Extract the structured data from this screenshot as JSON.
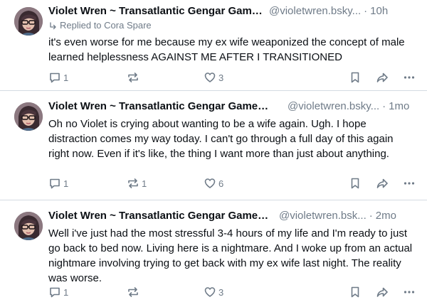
{
  "posts": [
    {
      "author": "Violet Wren ~ Transatlantic Gengar Gamer G...",
      "handle": "@violetwren.bsky...",
      "separator": "·",
      "time": "10h",
      "reply_to": "Replied to Cora Spare",
      "text": "it's even worse for me because my ex wife weaponized the concept of male learned helplessness AGAINST ME AFTER I TRANSITIONED",
      "replies": "1",
      "reposts": "",
      "likes": "3"
    },
    {
      "author": "Violet Wren ~ Transatlantic Gengar Gamer ...",
      "handle": "@violetwren.bsky...",
      "separator": "·",
      "time": "1mo",
      "text": "Oh no Violet is crying about wanting to be a wife again. Ugh. I hope distraction comes my way today. I can't go through a full day of this again right now. Even if it's like, the  thing I want more than just about anything.",
      "replies": "1",
      "reposts": "1",
      "likes": "6"
    },
    {
      "author": "Violet Wren ~ Transatlantic Gengar Gamer ...",
      "handle": "@violetwren.bsk...",
      "separator": "·",
      "time": "2mo",
      "text": "Well i've just had the most stressful 3-4 hours of my life and I'm ready to just go back to bed now. Living here is a nightmare. And I woke up from an actual nightmare involving trying to get back with my ex wife last night. The reality was worse.",
      "replies": "1",
      "reposts": "",
      "likes": "3"
    }
  ],
  "icons": {
    "reply": "speech-bubble-icon",
    "repost": "repost-arrows-icon",
    "like": "heart-icon",
    "save": "bookmark-icon",
    "share": "share-arrow-icon",
    "more": "more-dots-icon",
    "replied": "reply-arrow-icon"
  },
  "colors": {
    "muted": "#6f7b88",
    "text": "#0b0f14",
    "divider": "#d4dbe2"
  }
}
